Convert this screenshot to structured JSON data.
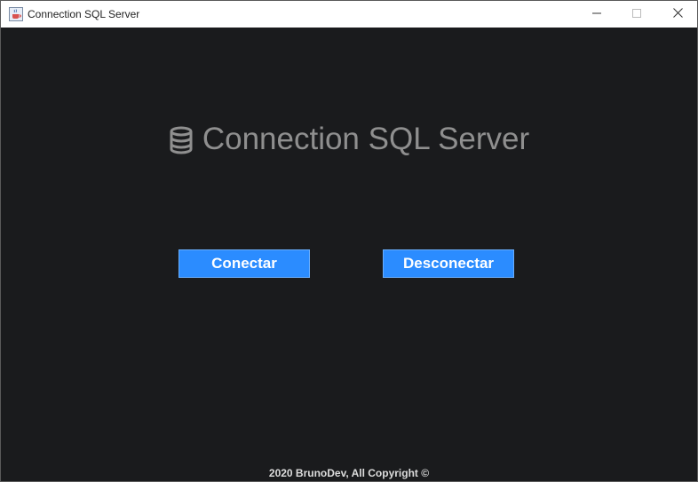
{
  "window": {
    "title": "Connection SQL Server",
    "icon": "java-cup-icon",
    "controls": {
      "minimize_icon": "minimize-icon",
      "maximize_icon": "maximize-icon",
      "close_icon": "close-icon"
    }
  },
  "main": {
    "heading": "Connection SQL Server",
    "heading_icon": "database-icon",
    "connect_label": "Conectar",
    "disconnect_label": "Desconectar"
  },
  "footer": {
    "text": "2020 BrunoDev, All Copyright ©"
  },
  "colors": {
    "background": "#1a1b1d",
    "button": "#2b8cff",
    "heading": "#8f8f8f",
    "footer": "#dcdcdc"
  }
}
